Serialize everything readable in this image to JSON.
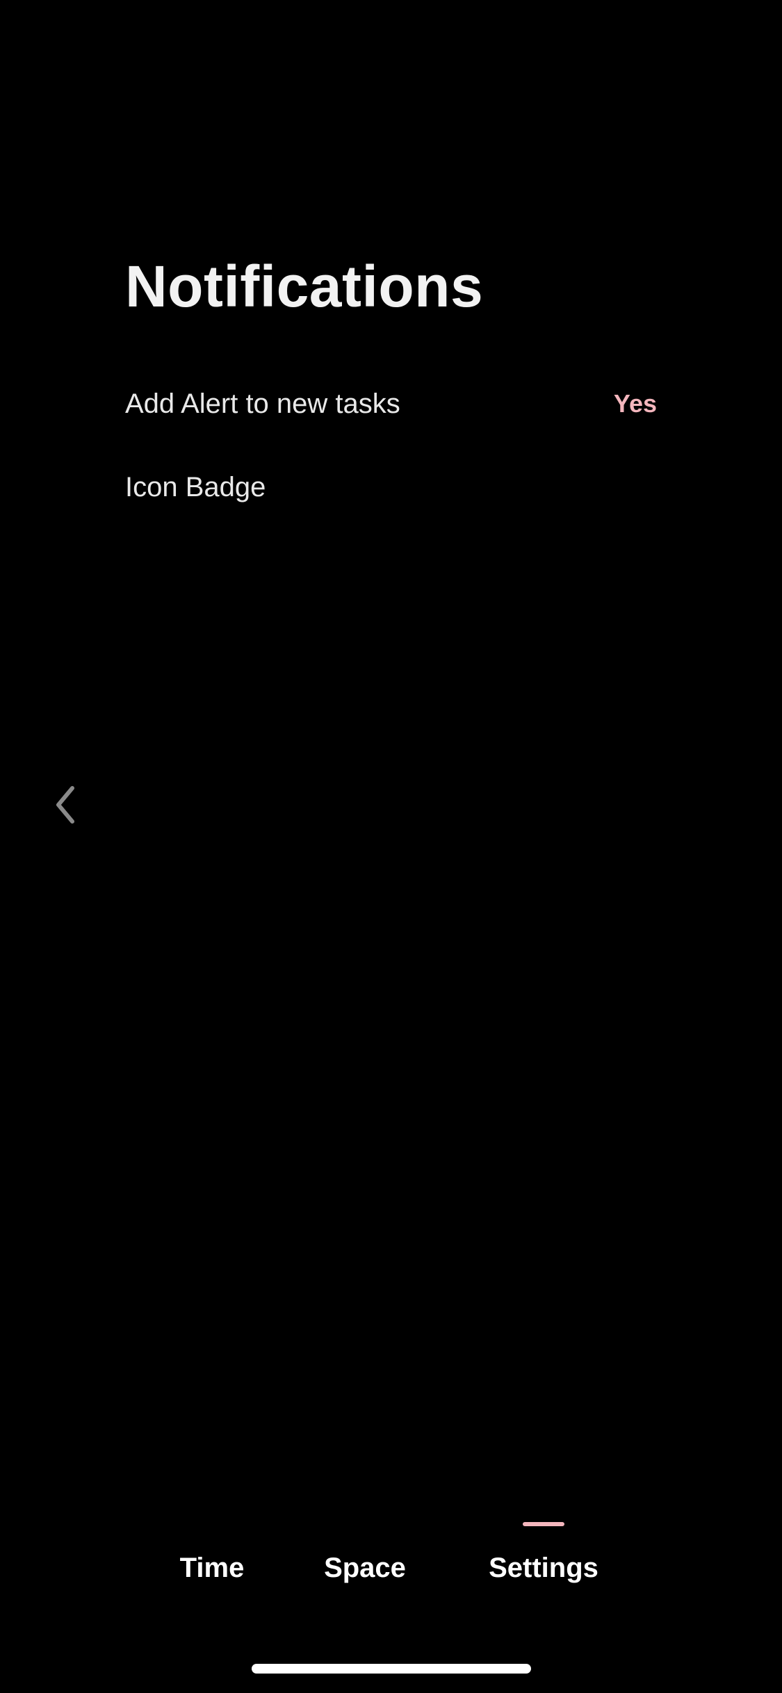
{
  "header": {
    "title": "Notifications"
  },
  "settings": [
    {
      "label": "Add Alert to new tasks",
      "value": "Yes"
    },
    {
      "label": "Icon Badge",
      "value": ""
    }
  ],
  "navigation": {
    "back_icon": "chevron-left-icon"
  },
  "tabs": [
    {
      "label": "Time",
      "active": false
    },
    {
      "label": "Space",
      "active": false
    },
    {
      "label": "Settings",
      "active": true
    }
  ],
  "colors": {
    "background": "#000000",
    "text": "#f2f2f2",
    "accent": "#f4b6bd"
  }
}
